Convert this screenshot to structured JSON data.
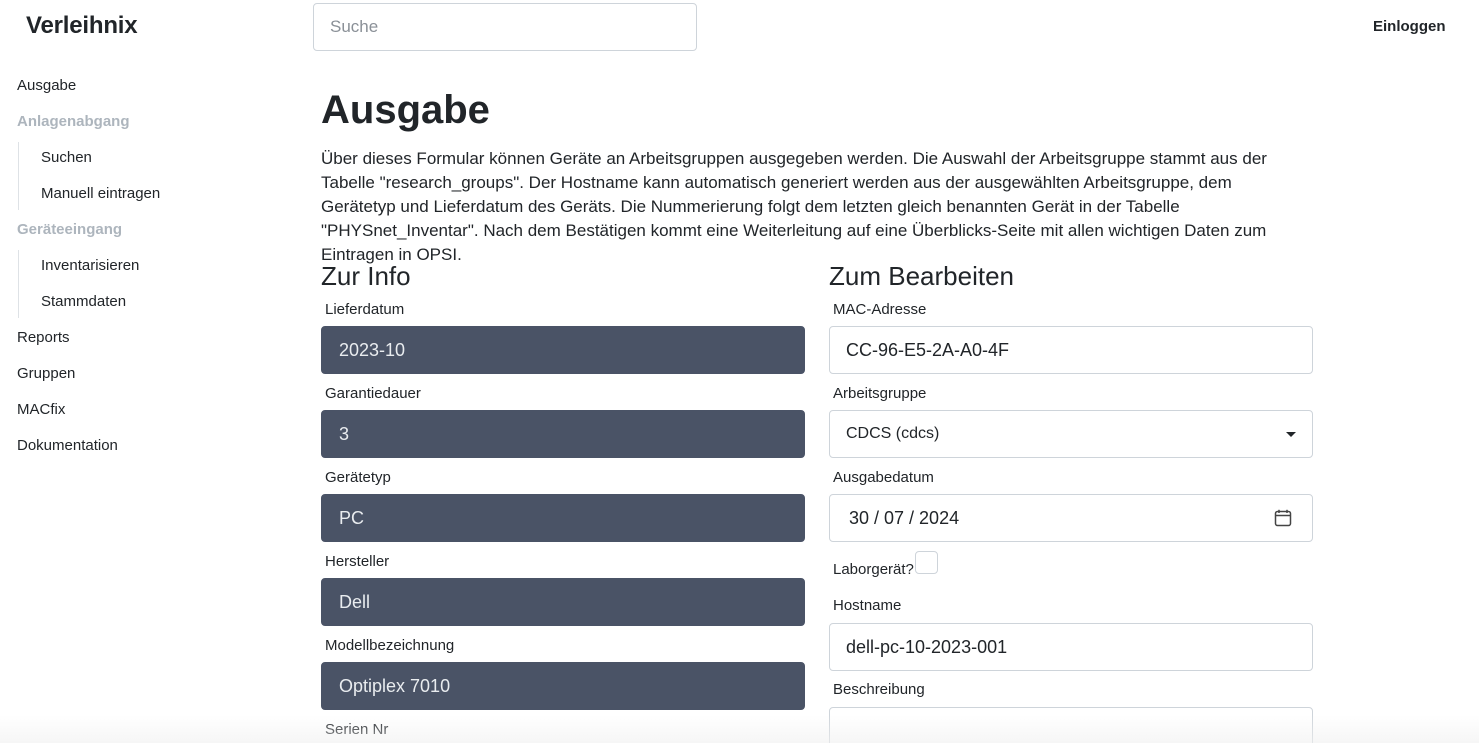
{
  "header": {
    "brand": "Verleihnix",
    "search_placeholder": "Suche",
    "login": "Einloggen"
  },
  "sidebar": {
    "items": [
      {
        "label": "Ausgabe"
      },
      {
        "label": "Anlagenabgang"
      },
      {
        "label": "Suchen"
      },
      {
        "label": "Manuell eintragen"
      },
      {
        "label": "Geräteeingang"
      },
      {
        "label": "Inventarisieren"
      },
      {
        "label": "Stammdaten"
      },
      {
        "label": "Reports"
      },
      {
        "label": "Gruppen"
      },
      {
        "label": "MACfix"
      },
      {
        "label": "Dokumentation"
      }
    ]
  },
  "main": {
    "title": "Ausgabe",
    "intro": "Über dieses Formular können Geräte an Arbeitsgruppen ausgegeben werden. Die Auswahl der Arbeitsgruppe stammt aus der Tabelle \"research_groups\". Der Hostname kann automatisch generiert werden aus der ausgewählten Arbeitsgruppe, dem Gerätetyp und Lieferdatum des Geräts. Die Nummerierung folgt dem letzten gleich benannten Gerät in der Tabelle \"PHYSnet_Inventar\". Nach dem Bestätigen kommt eine Weiterleitung auf eine Überblicks-Seite mit allen wichtigen Daten zum Eintragen in OPSI."
  },
  "info": {
    "heading": "Zur Info",
    "fields": [
      {
        "label": "Lieferdatum",
        "value": "2023-10"
      },
      {
        "label": "Garantiedauer",
        "value": "3"
      },
      {
        "label": "Gerätetyp",
        "value": "PC"
      },
      {
        "label": "Hersteller",
        "value": "Dell"
      },
      {
        "label": "Modellbezeichnung",
        "value": "Optiplex 7010"
      },
      {
        "label": "Serien Nr",
        "value": ""
      }
    ]
  },
  "edit": {
    "heading": "Zum Bearbeiten",
    "mac_label": "MAC-Adresse",
    "mac_value": "CC-96-E5-2A-A0-4F",
    "group_label": "Arbeitsgruppe",
    "group_value": "CDCS (cdcs)",
    "date_label": "Ausgabedatum",
    "date_value": "30 / 07 / 2024",
    "lab_label": "Laborgerät?",
    "hostname_label": "Hostname",
    "hostname_value": "dell-pc-10-2023-001",
    "description_label": "Beschreibung",
    "icons": {
      "select": "chevron-down-icon",
      "date": "calendar-icon"
    }
  }
}
